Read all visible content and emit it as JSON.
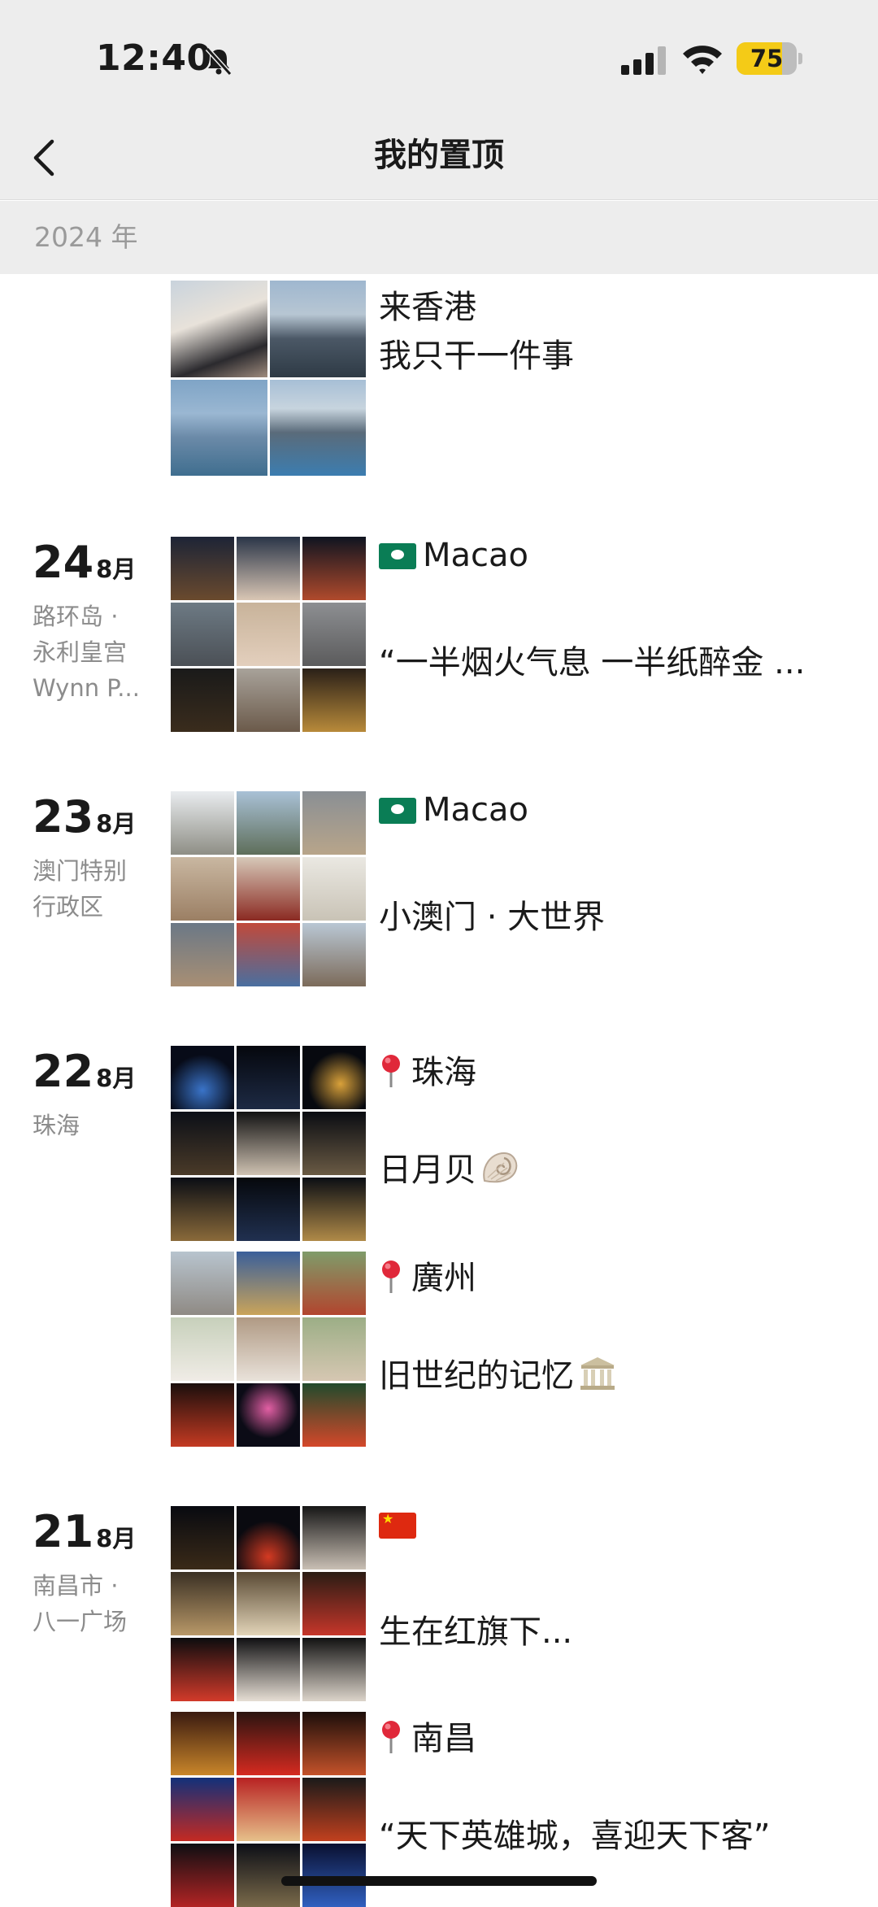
{
  "status_bar": {
    "time": "12:40",
    "battery_level": "75",
    "battery_fraction": 0.75,
    "battery_color": "#f4cb17"
  },
  "nav": {
    "title": "我的置顶"
  },
  "year_header": "2024 年",
  "posts": [
    {
      "day": "",
      "month": "",
      "location_lines": [],
      "tag": "来香港",
      "caption": "我只干一件事"
    },
    {
      "day": "24",
      "month": "8月",
      "location_lines": [
        "路环岛 ·",
        "永利皇宫",
        "Wynn P..."
      ],
      "tag": "Macao",
      "caption": "“一半烟火气息 一半纸醉金 ..."
    },
    {
      "day": "23",
      "month": "8月",
      "location_lines": [
        "澳门特别",
        "行政区"
      ],
      "tag": "Macao",
      "caption": "小澳门 · 大世界"
    },
    {
      "day": "22",
      "month": "8月",
      "location_lines": [
        "珠海"
      ],
      "tag": "珠海",
      "caption": "日月贝"
    },
    {
      "day": "",
      "month": "",
      "location_lines": [],
      "tag": "廣州",
      "caption": "旧世纪的记忆"
    },
    {
      "day": "21",
      "month": "8月",
      "location_lines": [
        "南昌市 ·",
        "八一广场"
      ],
      "tag": "",
      "caption": "生在红旗下..."
    },
    {
      "day": "",
      "month": "",
      "location_lines": [],
      "tag": "南昌",
      "caption": "“天下英雄城，喜迎天下客”"
    }
  ],
  "icons": {
    "back": "chevron-left-icon",
    "mute": "bell-slash-icon",
    "signal": "cellular-signal-icon",
    "wifi": "wifi-icon",
    "pin": "round-pushpin-icon",
    "shell": "spiral-shell-icon",
    "building": "classical-building-icon",
    "flag_macau": "macau-flag-icon",
    "flag_china": "china-flag-icon"
  }
}
